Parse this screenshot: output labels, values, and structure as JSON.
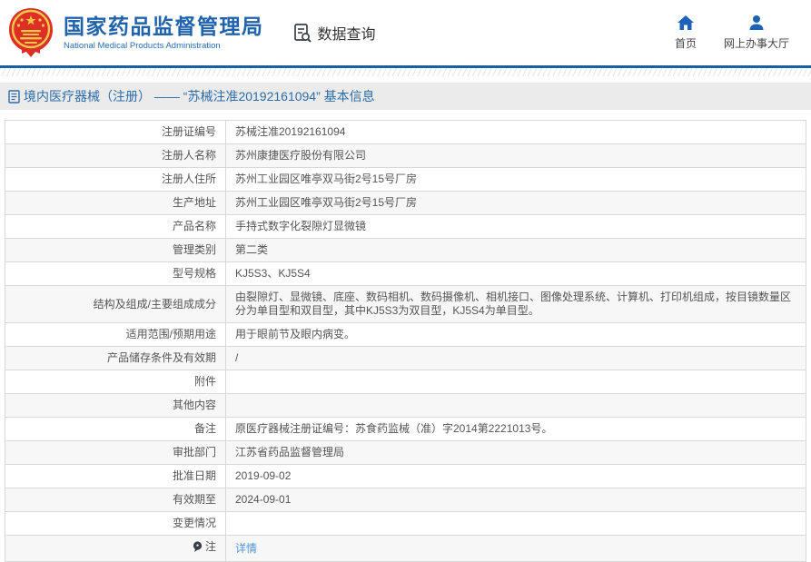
{
  "header": {
    "org_name_zh": "国家药品监督管理局",
    "org_name_en": "National Medical Products Administration",
    "data_query_label": "数据查询",
    "nav_home_label": "首页",
    "nav_hall_label": "网上办事大厅"
  },
  "colors": {
    "brand_blue": "#2063ac",
    "icon_blue": "#1b62b8",
    "divider_blue": "#1b5fa8",
    "breadcrumb_bg": "#ebebeb",
    "link_blue": "#5094d6",
    "emblem_red": "#de2f27",
    "emblem_gold": "#f2c74a",
    "row_alt_bg": "#f7f7f7"
  },
  "breadcrumb": {
    "title": "境内医疗器械（注册） —— “苏械注准20192161094” 基本信息"
  },
  "table": {
    "rows": [
      {
        "label": "注册证编号",
        "value": "苏械注准20192161094"
      },
      {
        "label": "注册人名称",
        "value": "苏州康捷医疗股份有限公司"
      },
      {
        "label": "注册人住所",
        "value": "苏州工业园区唯亭双马街2号15号厂房"
      },
      {
        "label": "生产地址",
        "value": "苏州工业园区唯亭双马街2号15号厂房"
      },
      {
        "label": "产品名称",
        "value": "手持式数字化裂隙灯显微镜"
      },
      {
        "label": "管理类别",
        "value": "第二类"
      },
      {
        "label": "型号规格",
        "value": "KJ5S3、KJ5S4"
      },
      {
        "label": "结构及组成/主要组成成分",
        "value": "由裂隙灯、显微镜、底座、数码相机、数码摄像机、相机接口、图像处理系统、计算机、打印机组成，按目镜数量区分为单目型和双目型，其中KJ5S3为双目型，KJ5S4为单目型。"
      },
      {
        "label": "适用范围/预期用途",
        "value": "用于眼前节及眼内病变。"
      },
      {
        "label": "产品储存条件及有效期",
        "value": "/"
      },
      {
        "label": "附件",
        "value": ""
      },
      {
        "label": "其他内容",
        "value": ""
      },
      {
        "label": "备注",
        "value": "原医疗器械注册证编号：苏食药监械（准）字2014第2221013号。"
      },
      {
        "label": "审批部门",
        "value": "江苏省药品监督管理局"
      },
      {
        "label": "批准日期",
        "value": "2019-09-02"
      },
      {
        "label": "有效期至",
        "value": "2024-09-01"
      },
      {
        "label": "变更情况",
        "value": ""
      },
      {
        "label": "注",
        "value": "详情",
        "label_icon": "note-icon",
        "value_is_link": true
      }
    ]
  }
}
